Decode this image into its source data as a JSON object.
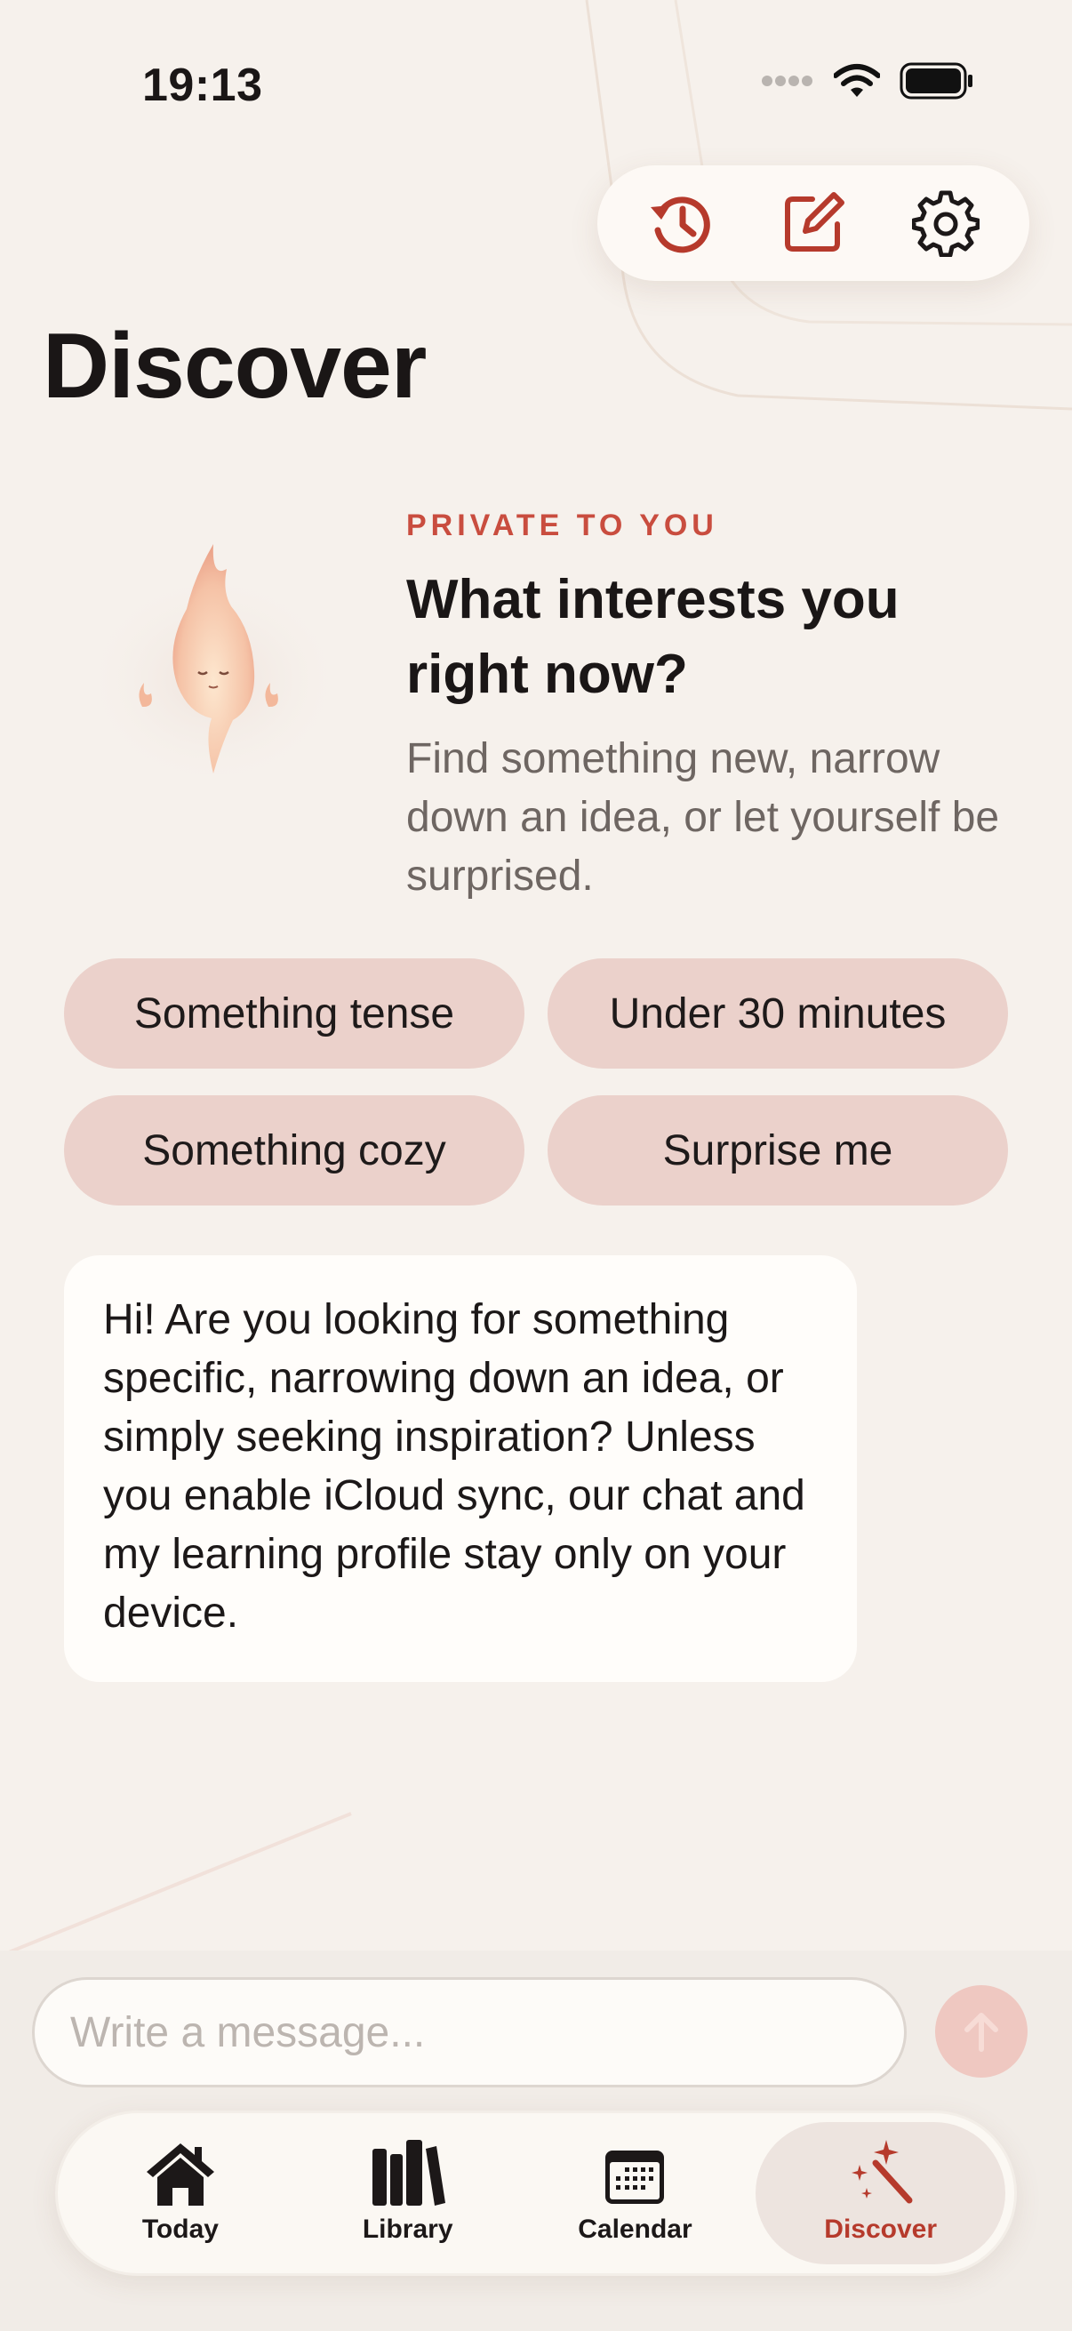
{
  "status_bar": {
    "time": "19:13"
  },
  "toolbar": {
    "history_icon": "history-icon",
    "compose_icon": "compose-icon",
    "settings_icon": "gear-icon"
  },
  "page": {
    "title": "Discover"
  },
  "hero": {
    "eyebrow": "PRIVATE TO YOU",
    "heading": "What interests you right now?",
    "subtitle": "Find something new, narrow down an idea, or let yourself be surprised."
  },
  "suggestions": [
    "Something tense",
    "Under 30 minutes",
    "Something cozy",
    "Surprise me"
  ],
  "assistant_message": "Hi! Are you looking for something specific, narrowing down an idea, or simply seeking inspiration? Unless you enable iCloud sync, our chat and my learning profile stay only on your device.",
  "composer": {
    "placeholder": "Write a message..."
  },
  "tabs": [
    {
      "label": "Today",
      "icon": "house-icon"
    },
    {
      "label": "Library",
      "icon": "books-icon"
    },
    {
      "label": "Calendar",
      "icon": "calendar-icon"
    },
    {
      "label": "Discover",
      "icon": "magic-wand-icon"
    }
  ],
  "colors": {
    "accent": "#c94d3f",
    "background": "#f6f1ec",
    "chip": "#ebd1cb"
  }
}
